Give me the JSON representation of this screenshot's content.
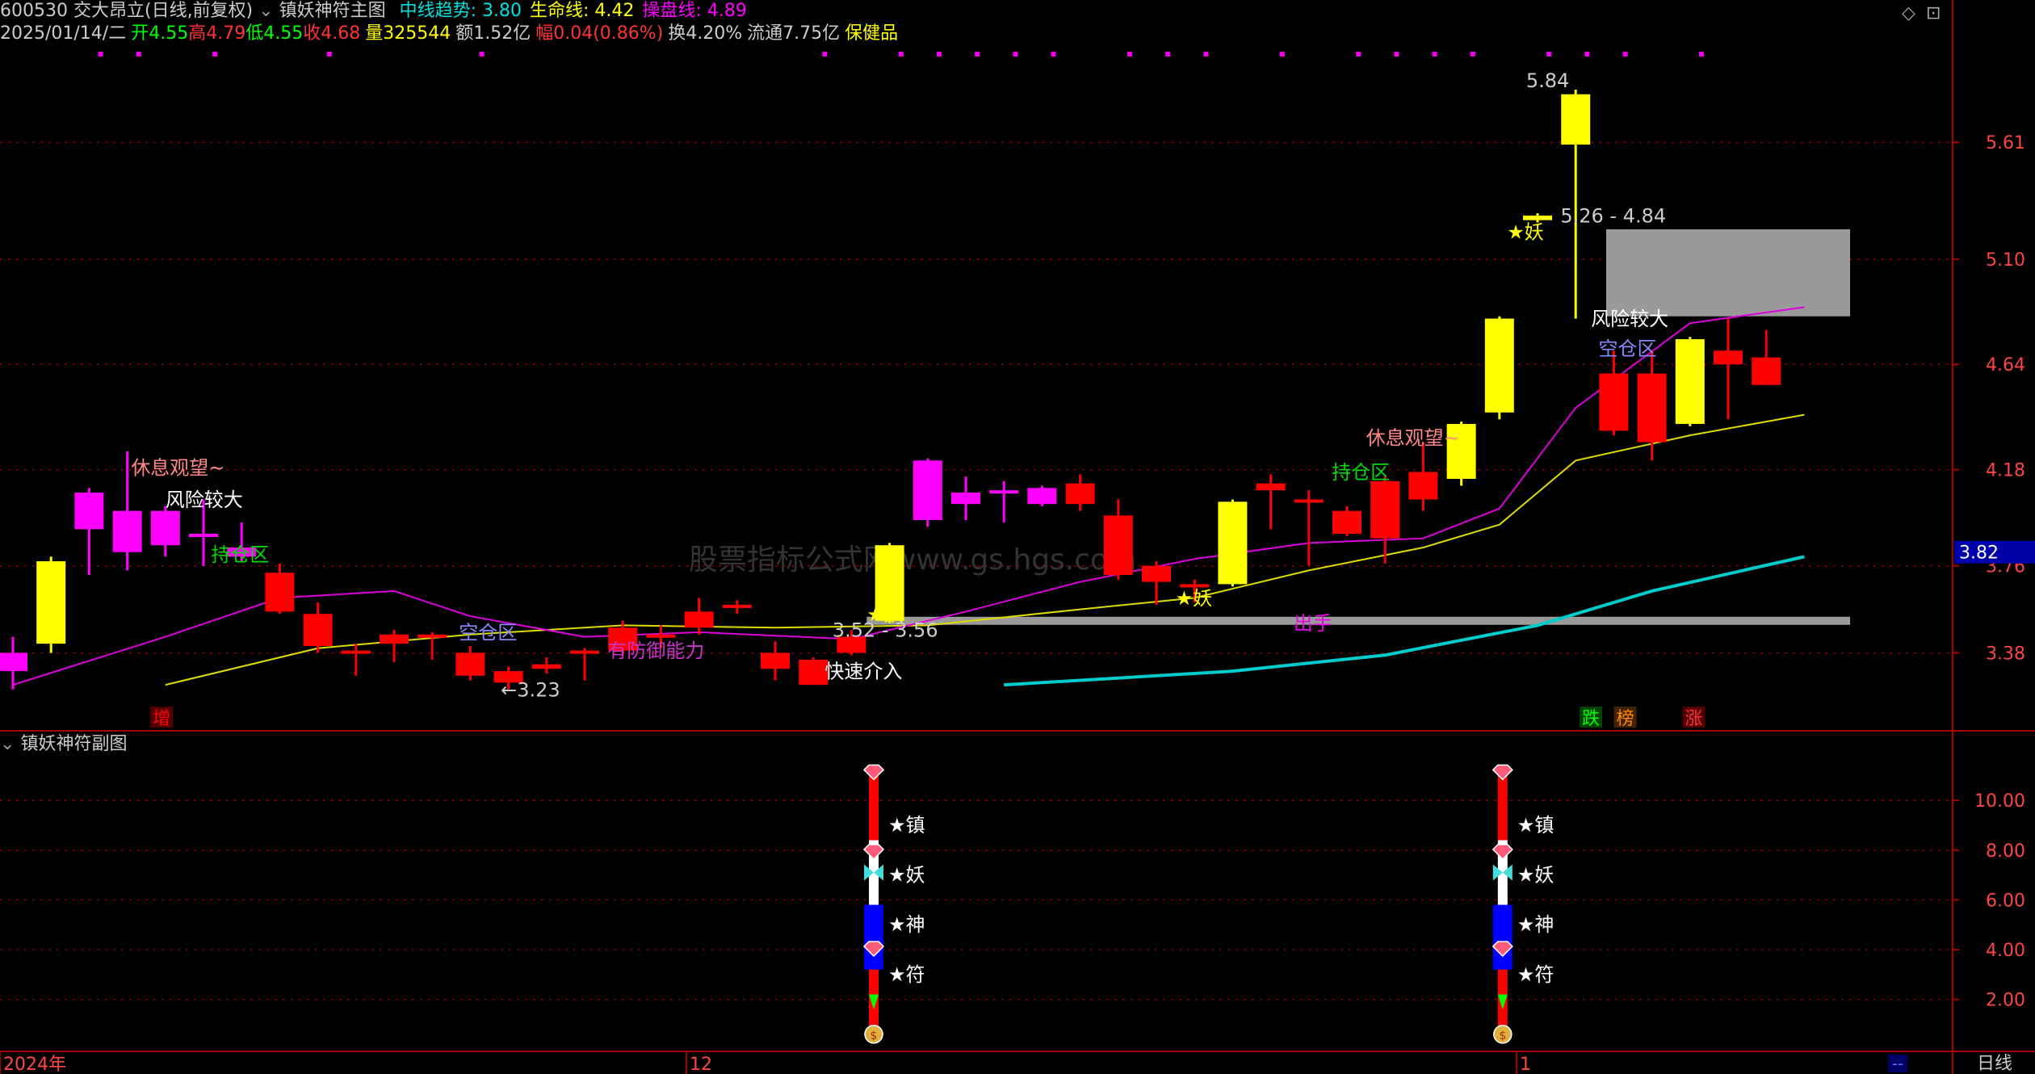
{
  "header": {
    "code": "600530",
    "name": "交大昂立(日线,前复权)",
    "indicator_name": "镇妖神符主图",
    "params": [
      {
        "label": "中线趋势: ",
        "value": "3.80",
        "color": "#00e0e0"
      },
      {
        "label": "生命线: ",
        "value": "4.42",
        "color": "#ffff00"
      },
      {
        "label": "操盘线: ",
        "value": "4.89",
        "color": "#ff00ff"
      }
    ],
    "row2": [
      {
        "text": "2025/01/14/二",
        "color": "#cccccc"
      },
      {
        "text": "开",
        "color": "#00ff00"
      },
      {
        "text": "4.55",
        "color": "#00ff00"
      },
      {
        "text": "高",
        "color": "#ff3333"
      },
      {
        "text": "4.79",
        "color": "#ff3333"
      },
      {
        "text": "低",
        "color": "#00ff00"
      },
      {
        "text": "4.55",
        "color": "#00ff00"
      },
      {
        "text": "收",
        "color": "#ff3333"
      },
      {
        "text": "4.68",
        "color": "#ff3333"
      },
      {
        "text": "量",
        "color": "#ffff00"
      },
      {
        "text": "325544",
        "color": "#ffff00"
      },
      {
        "text": "额1.52亿",
        "color": "#cccccc"
      },
      {
        "text": "幅",
        "color": "#ff3333"
      },
      {
        "text": "0.04(0.86%)",
        "color": "#ff3333"
      },
      {
        "text": "换4.20%",
        "color": "#cccccc"
      },
      {
        "text": "流通7.75亿",
        "color": "#cccccc"
      },
      {
        "text": "保健品",
        "color": "#ffff00"
      }
    ]
  },
  "window_controls": {
    "diamond": "◇",
    "restore": "⊡"
  },
  "main_axis": {
    "ticks": [
      5.61,
      5.1,
      4.64,
      4.18,
      3.76,
      3.38
    ],
    "tick_labels": [
      "5.61",
      "5.10",
      "4.64",
      "4.18",
      "3.76",
      "3.38"
    ],
    "current_price": "3.82",
    "min": 3.05,
    "max": 6.02
  },
  "sub_panel": {
    "title": "镇妖神符副图",
    "ticks": [
      "10.00",
      "8.00",
      "6.00",
      "4.00",
      "2.00"
    ],
    "values": [
      10,
      8,
      6,
      4,
      2
    ],
    "min": 0.3,
    "max": 11.5
  },
  "signal_labels": [
    "★镇",
    "★妖",
    "★神",
    "★符"
  ],
  "x_axis": {
    "labels": [
      "2024年",
      "12",
      "1"
    ],
    "period": "日线",
    "mini": "--"
  },
  "candles": [
    {
      "o": 3.3,
      "c": 3.38,
      "h": 3.45,
      "l": 3.22,
      "col": "m"
    },
    {
      "o": 3.42,
      "c": 3.78,
      "h": 3.8,
      "l": 3.38,
      "col": "y"
    },
    {
      "o": 3.92,
      "c": 4.08,
      "h": 4.1,
      "l": 3.72,
      "col": "m"
    },
    {
      "o": 3.82,
      "c": 4.0,
      "h": 4.26,
      "l": 3.74,
      "col": "m"
    },
    {
      "o": 3.85,
      "c": 4.0,
      "h": 4.02,
      "l": 3.8,
      "col": "m"
    },
    {
      "o": 3.9,
      "c": 3.9,
      "h": 4.05,
      "l": 3.76,
      "col": "m"
    },
    {
      "o": 3.8,
      "c": 3.84,
      "h": 3.95,
      "l": 3.78,
      "col": "m"
    },
    {
      "o": 3.73,
      "c": 3.56,
      "h": 3.77,
      "l": 3.55,
      "col": "r"
    },
    {
      "o": 3.55,
      "c": 3.41,
      "h": 3.6,
      "l": 3.38,
      "col": "r"
    },
    {
      "o": 3.39,
      "c": 3.38,
      "h": 3.42,
      "l": 3.28,
      "col": "r"
    },
    {
      "o": 3.42,
      "c": 3.46,
      "h": 3.48,
      "l": 3.34,
      "col": "r"
    },
    {
      "o": 3.45,
      "c": 3.46,
      "h": 3.47,
      "l": 3.35,
      "col": "r"
    },
    {
      "o": 3.38,
      "c": 3.28,
      "h": 3.41,
      "l": 3.26,
      "col": "r"
    },
    {
      "o": 3.3,
      "c": 3.25,
      "h": 3.32,
      "l": 3.22,
      "col": "r"
    },
    {
      "o": 3.31,
      "c": 3.33,
      "h": 3.36,
      "l": 3.29,
      "col": "r"
    },
    {
      "o": 3.39,
      "c": 3.38,
      "h": 3.4,
      "l": 3.26,
      "col": "r"
    },
    {
      "o": 3.49,
      "c": 3.39,
      "h": 3.52,
      "l": 3.37,
      "col": "r"
    },
    {
      "o": 3.46,
      "c": 3.46,
      "h": 3.5,
      "l": 3.4,
      "col": "r"
    },
    {
      "o": 3.56,
      "c": 3.49,
      "h": 3.62,
      "l": 3.46,
      "col": "r"
    },
    {
      "o": 3.59,
      "c": 3.59,
      "h": 3.61,
      "l": 3.55,
      "col": "r"
    },
    {
      "o": 3.38,
      "c": 3.31,
      "h": 3.43,
      "l": 3.26,
      "col": "r"
    },
    {
      "o": 3.35,
      "c": 3.24,
      "h": 3.36,
      "l": 3.24,
      "col": "r"
    },
    {
      "o": 3.45,
      "c": 3.38,
      "h": 3.48,
      "l": 3.37,
      "col": "r"
    },
    {
      "o": 3.52,
      "c": 3.85,
      "h": 3.86,
      "l": 3.51,
      "col": "y"
    },
    {
      "o": 3.96,
      "c": 4.22,
      "h": 4.23,
      "l": 3.93,
      "col": "m"
    },
    {
      "o": 4.03,
      "c": 4.08,
      "h": 4.15,
      "l": 3.96,
      "col": "m"
    },
    {
      "o": 4.08,
      "c": 4.09,
      "h": 4.13,
      "l": 3.95,
      "col": "m"
    },
    {
      "o": 4.03,
      "c": 4.1,
      "h": 4.11,
      "l": 4.02,
      "col": "m"
    },
    {
      "o": 4.12,
      "c": 4.03,
      "h": 4.16,
      "l": 4.0,
      "col": "r"
    },
    {
      "o": 3.98,
      "c": 3.72,
      "h": 4.05,
      "l": 3.7,
      "col": "r"
    },
    {
      "o": 3.76,
      "c": 3.69,
      "h": 3.78,
      "l": 3.59,
      "col": "r"
    },
    {
      "o": 3.68,
      "c": 3.67,
      "h": 3.7,
      "l": 3.6,
      "col": "r"
    },
    {
      "o": 3.68,
      "c": 4.04,
      "h": 4.05,
      "l": 3.67,
      "col": "y"
    },
    {
      "o": 4.12,
      "c": 4.09,
      "h": 4.16,
      "l": 3.92,
      "col": "r"
    },
    {
      "o": 4.05,
      "c": 4.05,
      "h": 4.09,
      "l": 3.76,
      "col": "r"
    },
    {
      "o": 4.0,
      "c": 3.9,
      "h": 4.02,
      "l": 3.89,
      "col": "r"
    },
    {
      "o": 4.13,
      "c": 3.88,
      "h": 4.15,
      "l": 3.77,
      "col": "r"
    },
    {
      "o": 4.17,
      "c": 4.05,
      "h": 4.3,
      "l": 4.0,
      "col": "r"
    },
    {
      "o": 4.14,
      "c": 4.38,
      "h": 4.39,
      "l": 4.11,
      "col": "y"
    },
    {
      "o": 4.43,
      "c": 4.84,
      "h": 4.85,
      "l": 4.4,
      "col": "y"
    },
    {
      "o": 5.27,
      "c": 5.29,
      "h": 5.3,
      "l": 5.26,
      "col": "y"
    },
    {
      "o": 5.6,
      "c": 5.82,
      "h": 5.84,
      "l": 4.84,
      "col": "y"
    },
    {
      "o": 4.6,
      "c": 4.35,
      "h": 4.7,
      "l": 4.33,
      "col": "r"
    },
    {
      "o": 4.6,
      "c": 4.3,
      "h": 4.7,
      "l": 4.22,
      "col": "r"
    },
    {
      "o": 4.38,
      "c": 4.75,
      "h": 4.76,
      "l": 4.37,
      "col": "y"
    },
    {
      "o": 4.7,
      "c": 4.64,
      "h": 4.84,
      "l": 4.4,
      "col": "r"
    },
    {
      "o": 4.67,
      "c": 4.55,
      "h": 4.79,
      "l": 4.55,
      "col": "r"
    }
  ],
  "lines": {
    "magenta": [
      [
        0,
        3.24
      ],
      [
        4,
        3.45
      ],
      [
        7,
        3.62
      ],
      [
        10,
        3.65
      ],
      [
        12,
        3.54
      ],
      [
        15,
        3.45
      ],
      [
        18,
        3.47
      ],
      [
        22,
        3.44
      ],
      [
        25,
        3.56
      ],
      [
        28,
        3.69
      ],
      [
        31,
        3.79
      ],
      [
        34,
        3.86
      ],
      [
        37,
        3.88
      ],
      [
        39,
        4.01
      ],
      [
        41,
        4.45
      ],
      [
        44,
        4.82
      ],
      [
        47,
        4.89
      ]
    ],
    "yellow": [
      [
        4,
        3.24
      ],
      [
        8,
        3.4
      ],
      [
        12,
        3.46
      ],
      [
        16,
        3.5
      ],
      [
        20,
        3.49
      ],
      [
        24,
        3.5
      ],
      [
        28,
        3.57
      ],
      [
        31,
        3.62
      ],
      [
        34,
        3.74
      ],
      [
        37,
        3.84
      ],
      [
        39,
        3.94
      ],
      [
        41,
        4.22
      ],
      [
        44,
        4.33
      ],
      [
        47,
        4.42
      ]
    ],
    "cyan": [
      [
        26,
        3.24
      ],
      [
        32,
        3.3
      ],
      [
        36,
        3.37
      ],
      [
        40,
        3.5
      ],
      [
        43,
        3.65
      ],
      [
        47,
        3.8
      ]
    ]
  },
  "bands": {
    "gray_band": {
      "from": 22.4,
      "to": 48.2,
      "price": 3.52
    },
    "gray_box": {
      "from": 41.8,
      "to": 48.2,
      "top": 5.23,
      "bottom": 4.85
    }
  },
  "annotations": [
    {
      "text": "休息观望~",
      "color": "#ff8888",
      "i": 3.1,
      "p": 4.16
    },
    {
      "text": "风险较大",
      "color": "#ffffff",
      "i": 4.0,
      "p": 4.02
    },
    {
      "text": "持仓区",
      "color": "#00dd00",
      "i": 5.2,
      "p": 3.78
    },
    {
      "text": "空仓区",
      "color": "#8888ff",
      "i": 11.7,
      "p": 3.44
    },
    {
      "text": "←3.23",
      "color": "#cccccc",
      "i": 12.8,
      "p": 3.19
    },
    {
      "text": "有防御能力",
      "color": "#cc33cc",
      "i": 15.6,
      "p": 3.36
    },
    {
      "text": "3.52 - 3.56",
      "color": "#cccccc",
      "i": 21.5,
      "p": 3.45
    },
    {
      "text": "快速介入",
      "color": "#ffffff",
      "i": 21.3,
      "p": 3.27
    },
    {
      "text": "★妖",
      "color": "#ffff00",
      "i": 22.4,
      "p": 3.52
    },
    {
      "text": "★妖",
      "color": "#ffff00",
      "i": 30.5,
      "p": 3.59
    },
    {
      "text": "出手",
      "color": "#ee00ee",
      "i": 33.6,
      "p": 3.48
    },
    {
      "text": "持仓区",
      "color": "#00dd00",
      "i": 34.6,
      "p": 4.14
    },
    {
      "text": "休息观望~",
      "color": "#ff8888",
      "i": 35.5,
      "p": 4.29
    },
    {
      "text": "★妖",
      "color": "#ffff00",
      "i": 39.2,
      "p": 5.19
    },
    {
      "text": "5.84",
      "color": "#cccccc",
      "i": 39.7,
      "p": 5.85
    },
    {
      "text": "5.26 - 4.84",
      "color": "#cccccc",
      "i": 40.6,
      "p": 5.26
    },
    {
      "text": "风险较大",
      "color": "#ffffff",
      "i": 41.4,
      "p": 4.81
    },
    {
      "text": "空仓区",
      "color": "#8888ff",
      "i": 41.6,
      "p": 4.68
    }
  ],
  "bottom_tags": [
    {
      "text": "增",
      "color": "#ff0000",
      "bg": "#550000",
      "i": 3.9
    },
    {
      "text": "跌",
      "color": "#00ff00",
      "bg": "#004400",
      "i": 41.4
    },
    {
      "text": "榜",
      "color": "#ff8800",
      "bg": "#442200",
      "i": 42.3
    },
    {
      "text": "涨",
      "color": "#ff3333",
      "bg": "#550000",
      "i": 44.1
    }
  ],
  "magenta_dots": [
    2.3,
    3.3,
    5.3,
    8.3,
    12.3,
    21.3,
    23.3,
    24.3,
    25.3,
    26.3,
    27.3,
    29.3,
    30.3,
    31.3,
    33.3,
    35.3,
    36.3,
    37.3,
    38.3,
    40.3,
    41.3,
    42.3,
    44.3
  ],
  "signal_columns": [
    22.5,
    39.0
  ]
}
